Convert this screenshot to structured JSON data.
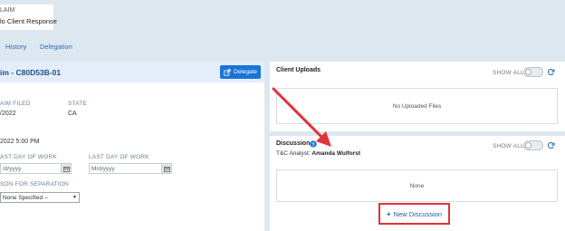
{
  "claim": {
    "label": "LAIM",
    "value": "lo Client Response"
  },
  "tabs": [
    {
      "label": "History"
    },
    {
      "label": "Delegation"
    }
  ],
  "left_panel": {
    "title": "im - C80D53B-01",
    "delegate_label": "Delegate",
    "claim_filed_label": "AIM FILED",
    "claim_filed_value": "/2022",
    "state_label": "STATE",
    "state_value": "CA",
    "timestamp": "2022 5:00 PM",
    "last_day_of_work_label_1": "AST DAY OF WORK",
    "last_day_of_work_placeholder_1": "/d/yyyy",
    "last_day_of_work_label_2": "LAST DAY OF WORK",
    "last_day_of_work_placeholder_2": "M/d/yyyy",
    "reason_label": "SON FOR SEPARATION",
    "reason_value": "None Specified --"
  },
  "client_uploads": {
    "title": "Client Uploads",
    "show_all": "SHOW ALL",
    "empty_text": "No Uploaded Files"
  },
  "discussion": {
    "title": "Discussion",
    "show_all": "SHOW ALL",
    "analyst_prefix": "T&C Analyst:",
    "analyst_name": "Amanda Wulforst",
    "empty_text": "None",
    "new_button": "New Discussion"
  },
  "colors": {
    "accent": "#1a73d9",
    "link": "#2c6db5",
    "highlight": "#e0333a",
    "background": "#dde7f0"
  },
  "icons": [
    "delegate-icon",
    "calendar-icon",
    "refresh-icon",
    "info-icon",
    "plus-icon",
    "annotation-arrow"
  ]
}
